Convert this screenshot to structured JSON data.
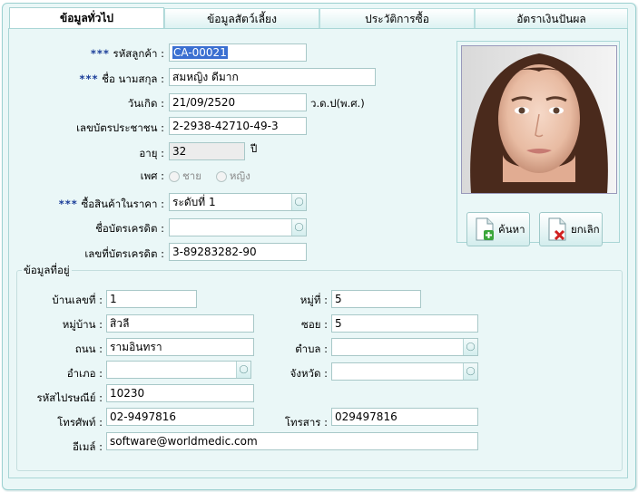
{
  "tabs": [
    {
      "label": "ข้อมูลทั่วไป",
      "active": true
    },
    {
      "label": "ข้อมูลสัตว์เลี้ยง",
      "active": false
    },
    {
      "label": "ประวัติการซื้อ",
      "active": false
    },
    {
      "label": "อัตราเงินปันผล",
      "active": false
    }
  ],
  "general": {
    "required_mark": "***",
    "customer_code_label": "รหัสลูกค้า :",
    "customer_code": "CA-00021",
    "name_label": "ชื่อ นามสกุล :",
    "name": "สมหญิง ดีมาก",
    "birthdate_label": "วันเกิด :",
    "birthdate": "21/09/2520",
    "birthdate_unit": "ว.ด.ป(พ.ศ.)",
    "id_card_label": "เลขบัตรประชาชน :",
    "id_card": "2-2938-42710-49-3",
    "age_label": "อายุ :",
    "age": "32",
    "age_unit": "ปี",
    "gender_label": "เพศ :",
    "gender_male": "ชาย",
    "gender_female": "หญิง",
    "price_level_label": "ซื้อสินค้าในราคา :",
    "price_level": "ระดับที่ 1",
    "credit_card_label": "ชื่อบัตรเครดิต :",
    "credit_card": "",
    "credit_card_no_label": "เลขที่บัตรเครดิต :",
    "credit_card_no": "3-89283282-90"
  },
  "photo": {
    "search_label": "ค้นหา",
    "cancel_label": "ยกเลิก"
  },
  "address": {
    "title": "ข้อมูลที่อยู่",
    "house_no_label": "บ้านเลขที่ :",
    "house_no": "1",
    "moo_label": "หมู่ที่ :",
    "moo": "5",
    "village_label": "หมู่บ้าน :",
    "village": "สิวลี",
    "soi_label": "ซอย :",
    "soi": "5",
    "road_label": "ถนน :",
    "road": "รามอินทรา",
    "subdistrict_label": "ตำบล :",
    "subdistrict": "",
    "district_label": "อำเภอ :",
    "district": "",
    "province_label": "จังหวัด :",
    "province": "",
    "postcode_label": "รหัสไปรษณีย์ :",
    "postcode": "10230",
    "phone_label": "โทรศัพท์ :",
    "phone": "02-9497816",
    "fax_label": "โทรสาร :",
    "fax": "029497816",
    "email_label": "อีเมล์ :",
    "email": "software@worldmedic.com"
  }
}
